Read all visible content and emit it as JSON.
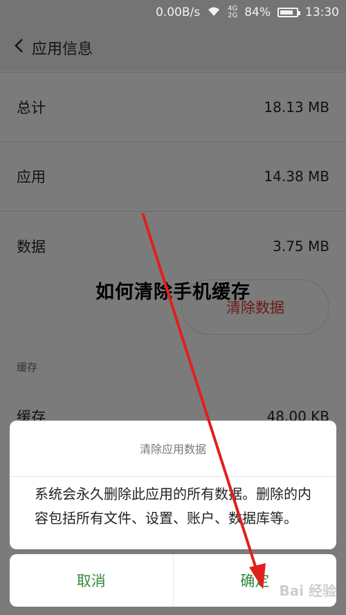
{
  "statusbar": {
    "speed": "0.00B/s",
    "net_top": "4G",
    "net_bottom": "2G",
    "battery_text": "84%",
    "battery_level": 0.84,
    "time": "13:30"
  },
  "header": {
    "title": "应用信息"
  },
  "storage": {
    "rows": [
      {
        "label": "总计",
        "value": "18.13 MB"
      },
      {
        "label": "应用",
        "value": "14.38 MB"
      },
      {
        "label": "数据",
        "value": "3.75 MB"
      }
    ],
    "clear_button": "清除数据"
  },
  "overlay_caption": "如何清除手机缓存",
  "cache": {
    "section_label": "缓存",
    "row_label": "缓存",
    "row_value": "48.00 KB"
  },
  "dialog": {
    "title": "清除应用数据",
    "message": "系统会永久删除此应用的所有数据。删除的内容包括所有文件、设置、账户、数据库等。",
    "cancel": "取消",
    "confirm": "确定"
  },
  "watermark": "Bai 经验",
  "colors": {
    "dim_background": "#7b7b7b",
    "accent_green": "#2e8a3a",
    "arrow_red": "#e0201a",
    "clear_text": "#6b1a17"
  }
}
